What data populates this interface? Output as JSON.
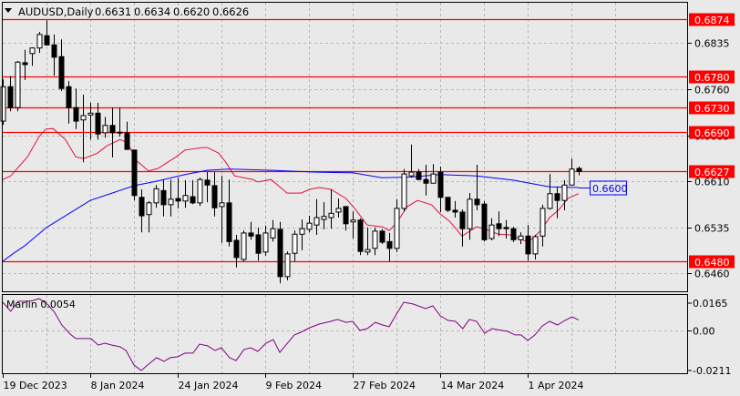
{
  "header": {
    "symbol": "AUDUSD,Daily",
    "open": "0.6631",
    "high": "0.6634",
    "low": "0.6620",
    "close": "0.6626",
    "menu_icon": "triangle-down-icon"
  },
  "indicator": {
    "label": "Marlin 0.0054"
  },
  "colors": {
    "background": "#e9e9e9",
    "level_line": "#ff0000",
    "fast_ma": "#e0103c",
    "slow_ma": "#0000ff",
    "oscillator": "#800080",
    "grid": "#b8b8b8"
  },
  "chart_data": [
    {
      "type": "candlestick",
      "title": "AUDUSD,Daily",
      "ylim": [
        0.642,
        0.691
      ],
      "y_ticks": [
        "0.6835",
        "0.6760",
        "0.6685",
        "0.6610",
        "0.6535",
        "0.6460"
      ],
      "levels": [
        "0.6874",
        "0.6780",
        "0.6730",
        "0.6690",
        "0.6627",
        "0.6480"
      ],
      "ma_label": "0.6600",
      "x_labels": [
        {
          "bar": 0,
          "label": "19 Dec 2023"
        },
        {
          "bar": 12,
          "label": "8 Jan 2024"
        },
        {
          "bar": 24,
          "label": "24 Jan 2024"
        },
        {
          "bar": 36,
          "label": "9 Feb 2024"
        },
        {
          "bar": 48,
          "label": "27 Feb 2024"
        },
        {
          "bar": 60,
          "label": "14 Mar 2024"
        },
        {
          "bar": 72,
          "label": "1 Apr 2024"
        }
      ],
      "ohlc": [
        [
          0.6708,
          0.6776,
          0.6702,
          0.6764
        ],
        [
          0.6764,
          0.6781,
          0.6724,
          0.673
        ],
        [
          0.673,
          0.6806,
          0.6724,
          0.6804
        ],
        [
          0.6803,
          0.6824,
          0.6775,
          0.68
        ],
        [
          0.6818,
          0.6828,
          0.6798,
          0.6827
        ],
        [
          0.6827,
          0.6853,
          0.6819,
          0.6849
        ],
        [
          0.6847,
          0.6872,
          0.6831,
          0.6832
        ],
        [
          0.6832,
          0.6849,
          0.6782,
          0.6812
        ],
        [
          0.6813,
          0.6841,
          0.6757,
          0.6761
        ],
        [
          0.6764,
          0.6773,
          0.6704,
          0.673
        ],
        [
          0.673,
          0.6761,
          0.6695,
          0.6708
        ],
        [
          0.671,
          0.6751,
          0.6641,
          0.6717
        ],
        [
          0.6718,
          0.6738,
          0.6678,
          0.6721
        ],
        [
          0.6721,
          0.6738,
          0.6678,
          0.6687
        ],
        [
          0.6689,
          0.6715,
          0.6681,
          0.6701
        ],
        [
          0.6701,
          0.673,
          0.6649,
          0.6689
        ],
        [
          0.669,
          0.673,
          0.6683,
          0.6689
        ],
        [
          0.6689,
          0.6707,
          0.6662,
          0.6662
        ],
        [
          0.6661,
          0.6661,
          0.6579,
          0.6587
        ],
        [
          0.6584,
          0.6597,
          0.6527,
          0.6554
        ],
        [
          0.6556,
          0.6578,
          0.6527,
          0.6575
        ],
        [
          0.6575,
          0.6604,
          0.6567,
          0.6598
        ],
        [
          0.6595,
          0.6613,
          0.6553,
          0.6572
        ],
        [
          0.6572,
          0.6613,
          0.6553,
          0.6581
        ],
        [
          0.6582,
          0.6616,
          0.6566,
          0.6578
        ],
        [
          0.6578,
          0.6612,
          0.6567,
          0.6587
        ],
        [
          0.6585,
          0.6612,
          0.6573,
          0.6575
        ],
        [
          0.6575,
          0.6616,
          0.657,
          0.6613
        ],
        [
          0.6612,
          0.6625,
          0.6576,
          0.6604
        ],
        [
          0.6603,
          0.6625,
          0.6553,
          0.6567
        ],
        [
          0.6569,
          0.6619,
          0.651,
          0.6575
        ],
        [
          0.6575,
          0.6613,
          0.6504,
          0.6512
        ],
        [
          0.6514,
          0.6523,
          0.647,
          0.6486
        ],
        [
          0.6483,
          0.653,
          0.648,
          0.6526
        ],
        [
          0.6526,
          0.6544,
          0.6515,
          0.6521
        ],
        [
          0.6523,
          0.6535,
          0.6481,
          0.6493
        ],
        [
          0.6495,
          0.6538,
          0.6489,
          0.6526
        ],
        [
          0.6518,
          0.6547,
          0.6512,
          0.6533
        ],
        [
          0.6532,
          0.6544,
          0.6444,
          0.6455
        ],
        [
          0.6455,
          0.6496,
          0.6449,
          0.6492
        ],
        [
          0.6493,
          0.653,
          0.648,
          0.6524
        ],
        [
          0.6524,
          0.6548,
          0.6498,
          0.6533
        ],
        [
          0.6532,
          0.6554,
          0.6527,
          0.6542
        ],
        [
          0.6539,
          0.6581,
          0.6523,
          0.6551
        ],
        [
          0.6548,
          0.6576,
          0.6532,
          0.6553
        ],
        [
          0.6551,
          0.6597,
          0.6533,
          0.6558
        ],
        [
          0.656,
          0.6582,
          0.6551,
          0.6566
        ],
        [
          0.6569,
          0.6569,
          0.653,
          0.6541
        ],
        [
          0.6544,
          0.6561,
          0.6517,
          0.6547
        ],
        [
          0.6547,
          0.655,
          0.649,
          0.6496
        ],
        [
          0.6495,
          0.6535,
          0.649,
          0.6499
        ],
        [
          0.6501,
          0.6535,
          0.649,
          0.6529
        ],
        [
          0.6529,
          0.6532,
          0.6508,
          0.6511
        ],
        [
          0.6512,
          0.6526,
          0.648,
          0.6501
        ],
        [
          0.6501,
          0.6581,
          0.6495,
          0.6566
        ],
        [
          0.6566,
          0.663,
          0.6561,
          0.6622
        ],
        [
          0.6619,
          0.667,
          0.6616,
          0.6625
        ],
        [
          0.6625,
          0.663,
          0.6612,
          0.6613
        ],
        [
          0.6613,
          0.6637,
          0.6587,
          0.6607
        ],
        [
          0.6607,
          0.6638,
          0.6607,
          0.6622
        ],
        [
          0.6625,
          0.6634,
          0.656,
          0.6584
        ],
        [
          0.6584,
          0.6584,
          0.656,
          0.6563
        ],
        [
          0.6563,
          0.6578,
          0.6551,
          0.656
        ],
        [
          0.656,
          0.6564,
          0.6504,
          0.6533
        ],
        [
          0.6533,
          0.6591,
          0.6515,
          0.6581
        ],
        [
          0.6581,
          0.6637,
          0.6563,
          0.6572
        ],
        [
          0.6573,
          0.6578,
          0.6512,
          0.6515
        ],
        [
          0.6517,
          0.655,
          0.6514,
          0.6539
        ],
        [
          0.6541,
          0.6561,
          0.6521,
          0.6533
        ],
        [
          0.6535,
          0.6547,
          0.6517,
          0.6533
        ],
        [
          0.6533,
          0.6536,
          0.6511,
          0.6515
        ],
        [
          0.6515,
          0.6527,
          0.6508,
          0.6521
        ],
        [
          0.6521,
          0.6539,
          0.6481,
          0.6492
        ],
        [
          0.6492,
          0.6523,
          0.6483,
          0.652
        ],
        [
          0.6521,
          0.6572,
          0.6504,
          0.6566
        ],
        [
          0.6566,
          0.6622,
          0.6564,
          0.659
        ],
        [
          0.659,
          0.6601,
          0.655,
          0.6579
        ],
        [
          0.6579,
          0.6612,
          0.6563,
          0.6604
        ],
        [
          0.6604,
          0.6647,
          0.6604,
          0.663
        ],
        [
          0.6631,
          0.6634,
          0.662,
          0.6626
        ]
      ],
      "fast_ma": [
        [
          0,
          0.6613
        ],
        [
          1.1,
          0.6619
        ],
        [
          3.4,
          0.665
        ],
        [
          5,
          0.6683
        ],
        [
          5.9,
          0.6695
        ],
        [
          6.9,
          0.6696
        ],
        [
          8.6,
          0.6678
        ],
        [
          10,
          0.665
        ],
        [
          11.1,
          0.6647
        ],
        [
          13,
          0.6656
        ],
        [
          14.3,
          0.6668
        ],
        [
          16.1,
          0.6678
        ],
        [
          17.1,
          0.6673
        ],
        [
          18.4,
          0.6643
        ],
        [
          20,
          0.6627
        ],
        [
          21.3,
          0.6631
        ],
        [
          23.8,
          0.665
        ],
        [
          25,
          0.6661
        ],
        [
          27.4,
          0.6665
        ],
        [
          28.1,
          0.6665
        ],
        [
          29.6,
          0.6656
        ],
        [
          30.6,
          0.6641
        ],
        [
          31.8,
          0.6619
        ],
        [
          34.3,
          0.6613
        ],
        [
          35,
          0.6609
        ],
        [
          36.8,
          0.6613
        ],
        [
          38,
          0.6601
        ],
        [
          39,
          0.6591
        ],
        [
          40.9,
          0.6591
        ],
        [
          42.1,
          0.6597
        ],
        [
          43.4,
          0.66
        ],
        [
          45,
          0.6597
        ],
        [
          47.1,
          0.6582
        ],
        [
          48.4,
          0.6564
        ],
        [
          50,
          0.6539
        ],
        [
          52.1,
          0.6536
        ],
        [
          53,
          0.653
        ],
        [
          54,
          0.6542
        ],
        [
          55.5,
          0.6569
        ],
        [
          56.9,
          0.6579
        ],
        [
          58.8,
          0.6572
        ],
        [
          60,
          0.6557
        ],
        [
          61.3,
          0.6545
        ],
        [
          63,
          0.6521
        ],
        [
          65,
          0.6536
        ],
        [
          66.3,
          0.6532
        ],
        [
          68,
          0.6524
        ],
        [
          69.6,
          0.6523
        ],
        [
          72.1,
          0.6511
        ],
        [
          73.8,
          0.653
        ],
        [
          75,
          0.6551
        ],
        [
          76.3,
          0.6564
        ],
        [
          77.5,
          0.6582
        ],
        [
          79,
          0.659
        ]
      ],
      "slow_ma": [
        [
          0,
          0.648
        ],
        [
          1.5,
          0.6493
        ],
        [
          3,
          0.6505
        ],
        [
          6,
          0.6535
        ],
        [
          12,
          0.6579
        ],
        [
          18,
          0.6603
        ],
        [
          21,
          0.661
        ],
        [
          25,
          0.6621
        ],
        [
          28,
          0.6628
        ],
        [
          31,
          0.663
        ],
        [
          37,
          0.6628
        ],
        [
          43,
          0.6625
        ],
        [
          48,
          0.6624
        ],
        [
          52,
          0.6616
        ],
        [
          56,
          0.6617
        ],
        [
          60,
          0.6621
        ],
        [
          65,
          0.6619
        ],
        [
          70,
          0.6612
        ],
        [
          75,
          0.6601
        ],
        [
          79,
          0.66
        ]
      ]
    },
    {
      "type": "line",
      "title": "Marlin 0.0054",
      "ylim": [
        -0.0211,
        0.0165
      ],
      "y_ticks": [
        "0.0165",
        "0.00",
        "-0.0211"
      ],
      "series": [
        [
          0,
          0.0146
        ],
        [
          1.1,
          0.0099
        ],
        [
          2.1,
          0.0151
        ],
        [
          3.75,
          0.0151
        ],
        [
          5,
          0.0165
        ],
        [
          6.25,
          0.0132
        ],
        [
          7.1,
          0.0094
        ],
        [
          8.1,
          0.0027
        ],
        [
          9.25,
          -0.002
        ],
        [
          10,
          -0.0044
        ],
        [
          12.1,
          -0.0044
        ],
        [
          13.1,
          -0.0078
        ],
        [
          14,
          -0.0068
        ],
        [
          15,
          -0.0078
        ],
        [
          16.1,
          -0.0087
        ],
        [
          16.9,
          -0.0106
        ],
        [
          18,
          -0.0182
        ],
        [
          19,
          -0.0211
        ],
        [
          20,
          -0.0178
        ],
        [
          21.1,
          -0.0144
        ],
        [
          22.1,
          -0.0163
        ],
        [
          23,
          -0.0144
        ],
        [
          24,
          -0.0139
        ],
        [
          25,
          -0.012
        ],
        [
          26.1,
          -0.012
        ],
        [
          27,
          -0.0073
        ],
        [
          28.1,
          -0.0082
        ],
        [
          29.1,
          -0.0106
        ],
        [
          30,
          -0.0092
        ],
        [
          31.1,
          -0.0144
        ],
        [
          32,
          -0.0159
        ],
        [
          33.1,
          -0.0101
        ],
        [
          34,
          -0.0092
        ],
        [
          35,
          -0.0111
        ],
        [
          36.1,
          -0.0068
        ],
        [
          37.1,
          -0.0049
        ],
        [
          38,
          -0.0116
        ],
        [
          39.25,
          -0.0059
        ],
        [
          40,
          -0.0025
        ],
        [
          40.9,
          -0.0011
        ],
        [
          42.1,
          0.0013
        ],
        [
          43.4,
          0.0032
        ],
        [
          45,
          0.0046
        ],
        [
          45.9,
          0.0056
        ],
        [
          47.1,
          0.0041
        ],
        [
          48,
          0.0046
        ],
        [
          49,
          -0.0001
        ],
        [
          50,
          0.0008
        ],
        [
          51.1,
          0.0041
        ],
        [
          52.1,
          0.0027
        ],
        [
          53,
          0.0018
        ],
        [
          54,
          0.0084
        ],
        [
          55,
          0.0146
        ],
        [
          56.25,
          0.0137
        ],
        [
          58,
          0.0113
        ],
        [
          59,
          0.0127
        ],
        [
          60,
          0.0075
        ],
        [
          61.1,
          0.0051
        ],
        [
          62.1,
          0.0046
        ],
        [
          63.1,
          0.0008
        ],
        [
          64,
          0.0056
        ],
        [
          65,
          0.0046
        ],
        [
          66.1,
          -0.0016
        ],
        [
          67.1,
          0.0008
        ],
        [
          68.4,
          -0.0001
        ],
        [
          69.25,
          -0.0006
        ],
        [
          70.25,
          -0.0025
        ],
        [
          71.1,
          -0.0025
        ],
        [
          72,
          -0.0054
        ],
        [
          73,
          -0.0025
        ],
        [
          74,
          0.0022
        ],
        [
          75,
          0.0046
        ],
        [
          76.1,
          0.0027
        ],
        [
          77.1,
          0.0051
        ],
        [
          78.1,
          0.007
        ],
        [
          79,
          0.0054
        ]
      ]
    }
  ]
}
